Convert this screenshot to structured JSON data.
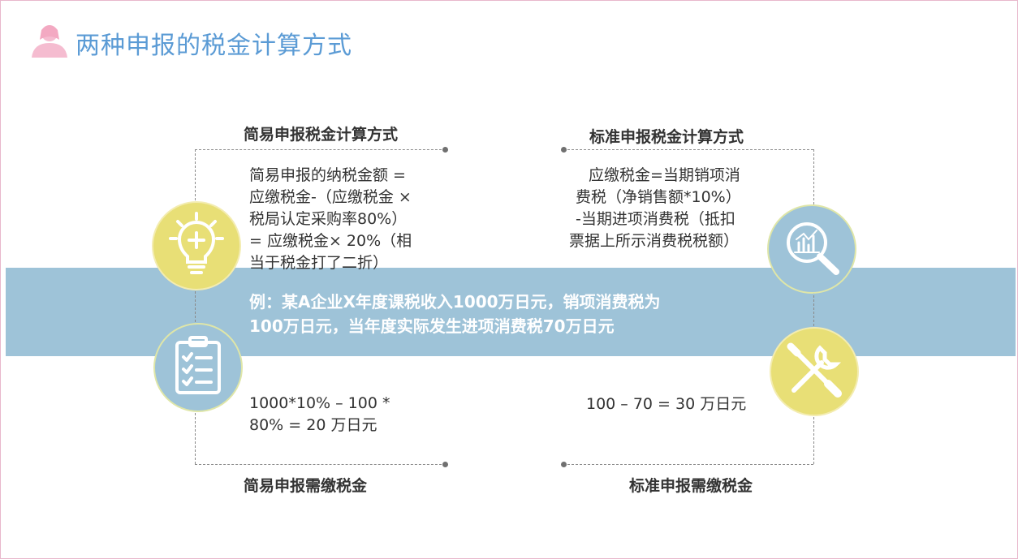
{
  "title": "两种申报的税金计算方式",
  "icons": {
    "title_icon": "person-icon",
    "top_left": "lightbulb-icon",
    "top_right": "magnifier-chart-icon",
    "bottom_left": "clipboard-checklist-icon",
    "bottom_right": "wrench-screwdriver-icon"
  },
  "colors": {
    "title": "#5b9bd5",
    "band": "#9ec3d8",
    "yellow_circle": "#e8df76",
    "blue_circle": "#9ec3d8"
  },
  "simple": {
    "heading": "简易申报税金计算方式",
    "formula_lines": [
      "简易申报的纳税金额 =",
      "应缴税金-（应缴税金 ×",
      "税局认定采购率80%）",
      "= 应缴税金× 20%（相",
      "当于税金打了二折）"
    ],
    "result_heading": "简易申报需缴税金",
    "result_lines": [
      "1000*10% – 100 *",
      "80% = 20 万日元"
    ]
  },
  "standard": {
    "heading": "标准申报税金计算方式",
    "formula_lines": [
      "应缴税金=当期销项消",
      "费税（净销售额*10%）",
      "-当期进项消费税（抵扣",
      "票据上所示消费税税额）"
    ],
    "result_heading": "标准申报需缴税金",
    "result_lines": [
      "100 – 70 = 30 万日元"
    ]
  },
  "example": {
    "lines": [
      "例：某A企业X年度课税收入1000万日元，销项消费税为",
      "100万日元，当年度实际发生进项消费税70万日元"
    ]
  }
}
